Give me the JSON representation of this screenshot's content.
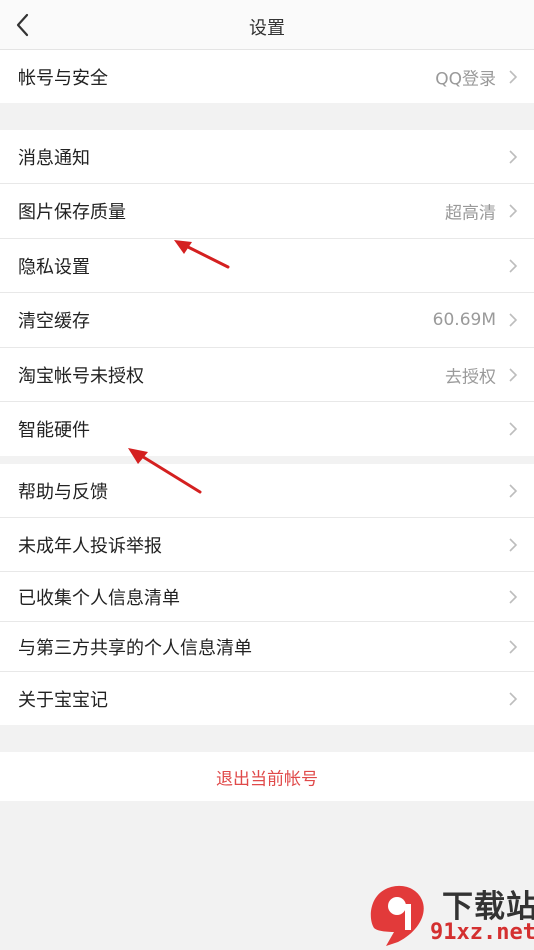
{
  "header": {
    "title": "设置"
  },
  "group1": [
    {
      "label": "帐号与安全",
      "value": "QQ登录"
    }
  ],
  "group2": [
    {
      "label": "消息通知",
      "value": ""
    },
    {
      "label": "图片保存质量",
      "value": "超高清"
    },
    {
      "label": "隐私设置",
      "value": ""
    },
    {
      "label": "清空缓存",
      "value": "60.69M"
    },
    {
      "label": "淘宝帐号未授权",
      "value": "去授权"
    },
    {
      "label": "智能硬件",
      "value": ""
    }
  ],
  "group3": [
    {
      "label": "帮助与反馈",
      "value": ""
    },
    {
      "label": "未成年人投诉举报",
      "value": ""
    },
    {
      "label": "已收集个人信息清单",
      "value": ""
    },
    {
      "label": "与第三方共享的个人信息清单",
      "value": ""
    },
    {
      "label": "关于宝宝记",
      "value": ""
    }
  ],
  "logout": {
    "label": "退出当前帐号"
  },
  "watermark": {
    "text": "下载站",
    "url": "91xz.net"
  },
  "colors": {
    "annotation_arrow": "#d42020",
    "logout_text": "#e04a4a"
  }
}
